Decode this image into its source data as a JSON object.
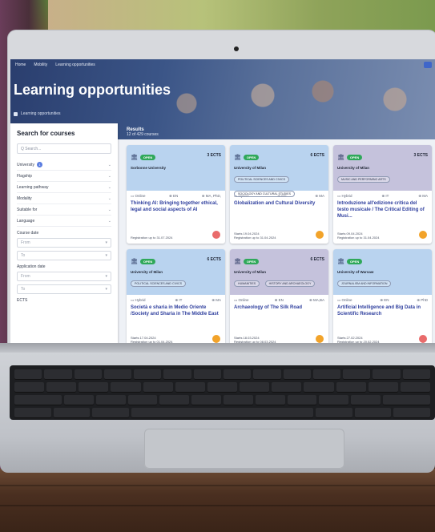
{
  "colors": {
    "card_blue": "#b9d3ef",
    "card_purple": "#c5c2dc",
    "dot_red": "#e96b6b",
    "dot_orange": "#f2a32a",
    "open_green": "#2fa85a",
    "title_blue": "#2f3f9e"
  },
  "topbar": {
    "items": [
      "Home",
      "Mobility",
      "Learning opportunities"
    ]
  },
  "hero": {
    "title": "Learning opportunities",
    "crumb": "Learning opportunities"
  },
  "sidebar": {
    "title": "Search for courses",
    "search_placeholder": "Q  Search...",
    "filters": [
      {
        "label": "University",
        "badge": "1"
      },
      {
        "label": "Flagship"
      },
      {
        "label": "Learning pathway"
      },
      {
        "label": "Modality"
      },
      {
        "label": "Suitable for"
      },
      {
        "label": "Language"
      }
    ],
    "course_date": {
      "label": "Course date",
      "from": "From",
      "to": "To"
    },
    "application_date": {
      "label": "Application date",
      "from": "From",
      "to": "To"
    },
    "ects_label": "ECTS"
  },
  "results": {
    "title": "Results",
    "count": "12 of 429 courses"
  },
  "cards": [
    {
      "status": "OPEN",
      "ects": "3 ECTS",
      "university": "Sorbonne University",
      "tags": [],
      "modality": "Online",
      "language": "EN",
      "level": "MA, PhD,",
      "title": "Thinking AI: Bringing together ethical, legal and social aspects of AI",
      "starts": "",
      "registration": "Registration up to 31.07.2024",
      "dot": "red"
    },
    {
      "status": "OPEN",
      "ects": "6 ECTS",
      "university": "University of Milan",
      "tags": [
        "POLITICAL SCIENCES AND CIVICS",
        "SOCIOLOGY AND CULTURAL STUDIES"
      ],
      "modality": "Hybrid",
      "language": "EN",
      "level": "MA",
      "title": "Globalization and Cultural Diversity",
      "starts": "Starts 19.04.2024",
      "registration": "Registration up to 31.04.2024",
      "dot": "orange"
    },
    {
      "status": "OPEN",
      "ects": "3 ECTS",
      "university": "University of Milan",
      "tags": [
        "MUSIC AND PERFORMING ARTS"
      ],
      "modality": "Hybrid",
      "language": "IT",
      "level": "MA",
      "title": "Introduzione all'edizione critica del testo musicale / The Critical Editing of Musi...",
      "starts": "Starts 09.04.2024",
      "registration": "Registration up to 31.04.2024",
      "dot": "orange"
    },
    {
      "status": "OPEN",
      "ects": "6 ECTS",
      "university": "University of Milan",
      "tags": [
        "POLITICAL SCIENCES AND CIVICS"
      ],
      "modality": "Hybrid",
      "language": "IT",
      "level": "MA",
      "title": "Società e sharia in Medio Oriente /Society and Sharia in The Middle East",
      "starts": "Starts 17.04.2024",
      "registration": "Registration up to 01.04.2024",
      "dot": "orange"
    },
    {
      "status": "OPEN",
      "ects": "6 ECTS",
      "university": "University of Milan",
      "tags": [
        "HUMANITIES",
        "HISTORY AND ARCHAEOLOGY"
      ],
      "modality": "Online",
      "language": "EN",
      "level": "MA,BA",
      "title": "Archaeology of The Silk Road",
      "starts": "Starts 18.03.2024",
      "registration": "Registration up to 08.03.2024",
      "dot": "orange"
    },
    {
      "status": "OPEN",
      "ects": "",
      "university": "University of Warsaw",
      "tags": [
        "JOURNALISM AND INFORMATION"
      ],
      "modality": "Online",
      "language": "EN",
      "level": "PhD",
      "title": "Artificial Intelligence and Big Data in Scientific Research",
      "starts": "Starts 27.02.2024",
      "registration": "Registration up to 20.02.2024",
      "dot": "red"
    }
  ]
}
